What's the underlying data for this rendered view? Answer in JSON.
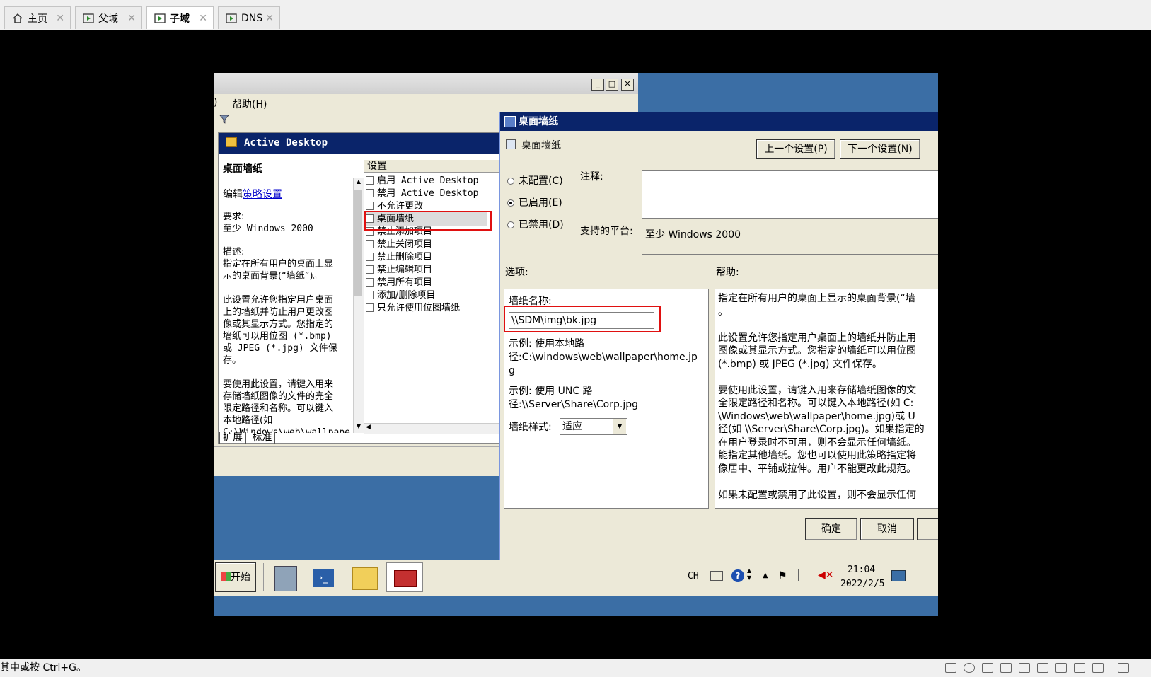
{
  "host_tabs": [
    {
      "label": "主页",
      "icon": "home-icon",
      "active": false
    },
    {
      "label": "父域",
      "icon": "vm-icon",
      "active": false
    },
    {
      "label": "子域",
      "icon": "vm-icon",
      "active": true
    },
    {
      "label": "DNS",
      "icon": "vm-icon",
      "active": false
    }
  ],
  "status_bar": {
    "text": "其中或按 Ctrl+G。"
  },
  "gp_editor": {
    "menu_fragment": ")",
    "menu_help": "帮助(H)",
    "panel_title": "Active Desktop",
    "policy_name": "桌面墙纸",
    "edit_prefix": "编辑",
    "edit_link": "策略设置",
    "requirements_label": "要求:",
    "requirements_value": "至少 Windows 2000",
    "description_label": "描述:",
    "description_lines": [
      "指定在所有用户的桌面上显",
      "示的桌面背景(“墙纸”)。",
      "",
      "此设置允许您指定用户桌面",
      "上的墙纸并防止用户更改图",
      "像或其显示方式。您指定的",
      "墙纸可以用位图 (*.bmp)",
      "或 JPEG (*.jpg) 文件保",
      "存。",
      "",
      "要使用此设置，请键入用来",
      "存储墙纸图像的文件的完全",
      "限定路径和名称。可以键入",
      "本地路径(如",
      "C:\\Windows\\web\\wallpape"
    ],
    "settings_header": "设置",
    "settings_items": [
      "启用 Active Desktop",
      "禁用 Active Desktop",
      "不允许更改",
      "桌面墙纸",
      "禁止添加项目",
      "禁止关闭项目",
      "禁止删除项目",
      "禁止编辑项目",
      "禁用所有项目",
      "添加/删除项目",
      "只允许使用位图墙纸"
    ],
    "bottom_tabs": [
      "扩展",
      "标准"
    ]
  },
  "dialog": {
    "title": "桌面墙纸",
    "setting_name": "桌面墙纸",
    "prev_button": "上一个设置(P)",
    "next_button": "下一个设置(N)",
    "radio_not_configured": "未配置(C)",
    "radio_enabled": "已启用(E)",
    "radio_disabled": "已禁用(D)",
    "comment_label": "注释:",
    "platform_label": "支持的平台:",
    "platform_value": "至少 Windows 2000",
    "options_label": "选项:",
    "help_label": "帮助:",
    "wallpaper_name_label": "墙纸名称:",
    "wallpaper_path": "\\\\SDM\\img\\bk.jpg",
    "example_local_1": "示例: 使用本地路",
    "example_local_2": "径:C:\\windows\\web\\wallpaper\\home.jp",
    "example_local_3": "g",
    "example_unc_1": "示例: 使用 UNC 路",
    "example_unc_2": "径:\\\\Server\\Share\\Corp.jpg",
    "style_label": "墙纸样式:",
    "style_value": "适应",
    "help_lines": [
      "指定在所有用户的桌面上显示的桌面背景(“墙",
      "。",
      "",
      "此设置允许您指定用户桌面上的墙纸并防止用",
      "图像或其显示方式。您指定的墙纸可以用位图",
      "(*.bmp) 或 JPEG (*.jpg) 文件保存。",
      "",
      "要使用此设置，请键入用来存储墙纸图像的文",
      "全限定路径和名称。可以键入本地路径(如 C:",
      "\\Windows\\web\\wallpaper\\home.jpg)或 U",
      "径(如 \\\\Server\\Share\\Corp.jpg)。如果指定的",
      "在用户登录时不可用，则不会显示任何墙纸。",
      "能指定其他墙纸。您也可以使用此策略指定将",
      "像居中、平铺或拉伸。用户不能更改此规范。",
      "",
      "如果未配置或禁用了此设置，则不会显示任何"
    ],
    "ok_button": "确定",
    "cancel_button": "取消"
  },
  "taskbar": {
    "start_label": "开始",
    "ime": "CH",
    "time": "21:04",
    "date": "2022/2/5"
  },
  "colors": {
    "highlight_red": "#e01010",
    "desktop": "#3b6ea5",
    "panel_header": "#0a246a"
  }
}
